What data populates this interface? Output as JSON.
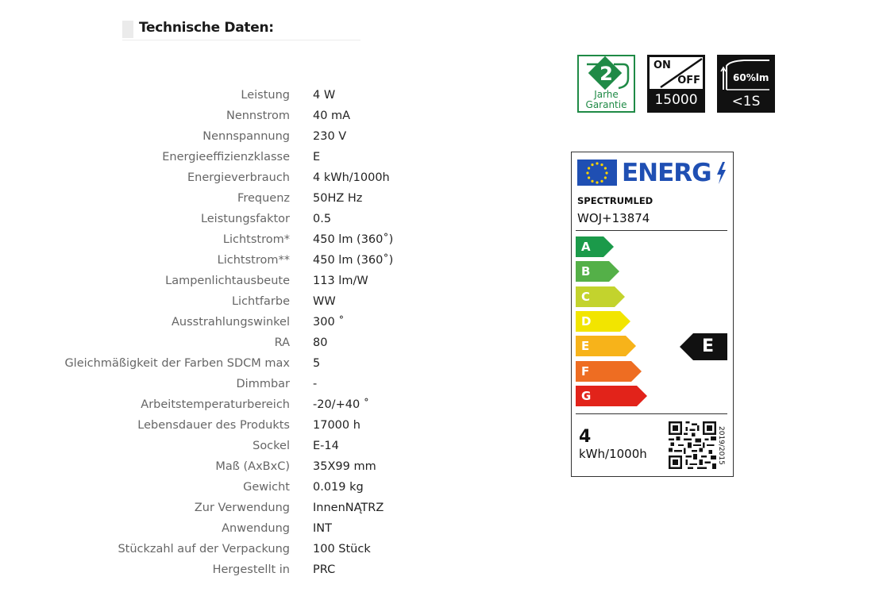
{
  "heading": {
    "title": "Technische Daten:"
  },
  "specs": [
    {
      "label": "Leistung",
      "value": "4 W"
    },
    {
      "label": "Nennstrom",
      "value": "40 mA"
    },
    {
      "label": "Nennspannung",
      "value": "230 V"
    },
    {
      "label": "Energieeffizienzklasse",
      "value": "E"
    },
    {
      "label": "Energieverbrauch",
      "value": "4 kWh/1000h"
    },
    {
      "label": "Frequenz",
      "value": "50HZ Hz"
    },
    {
      "label": "Leistungsfaktor",
      "value": "0.5"
    },
    {
      "label": "Lichtstrom*",
      "value": "450 lm (360˚)"
    },
    {
      "label": "Lichtstrom**",
      "value": "450 lm (360˚)"
    },
    {
      "label": "Lampenlichtausbeute",
      "value": "113 lm/W"
    },
    {
      "label": "Lichtfarbe",
      "value": "WW"
    },
    {
      "label": "Ausstrahlungswinkel",
      "value": "300 ˚"
    },
    {
      "label": "RA",
      "value": "80"
    },
    {
      "label": "Gleichmäßigkeit der Farben SDCM max",
      "value": "5"
    },
    {
      "label": "Dimmbar",
      "value": "-"
    },
    {
      "label": "Arbeitstemperaturbereich",
      "value": "-20/+40 ˚"
    },
    {
      "label": "Lebensdauer des Produkts",
      "value": "17000 h"
    },
    {
      "label": "Sockel",
      "value": "E-14"
    },
    {
      "label": "Maß (AxBxC)",
      "value": "35X99 mm"
    },
    {
      "label": "Gewicht",
      "value": "0.019 kg"
    },
    {
      "label": "Zur Verwendung",
      "value": "InnenNĄTRZ"
    },
    {
      "label": "Anwendung",
      "value": "INT"
    },
    {
      "label": "Stückzahl auf der Verpackung",
      "value": "100 Stück"
    },
    {
      "label": "Hergestellt in",
      "value": "PRC"
    }
  ],
  "badges": {
    "warranty": {
      "number": "2",
      "line1": "Jarhe",
      "line2": "Garantie",
      "color": "#1f8a46"
    },
    "switching": {
      "on": "ON",
      "off": "OFF",
      "cycles": "15000"
    },
    "startup": {
      "percent": "60%lm",
      "time": "<1S"
    }
  },
  "energy_label": {
    "word": "ENERG",
    "supplier": "SPECTRUMLED",
    "model": "WOJ+13874",
    "classes": [
      {
        "letter": "A",
        "color": "#1b9a4a"
      },
      {
        "letter": "B",
        "color": "#54b048"
      },
      {
        "letter": "C",
        "color": "#c3d32d"
      },
      {
        "letter": "D",
        "color": "#f2e500"
      },
      {
        "letter": "E",
        "color": "#f7b31a"
      },
      {
        "letter": "F",
        "color": "#ee6d22"
      },
      {
        "letter": "G",
        "color": "#e2231a"
      }
    ],
    "rating": "E",
    "consumption": "4",
    "unit": "kWh/1000h",
    "regulation": "2019/2015"
  }
}
